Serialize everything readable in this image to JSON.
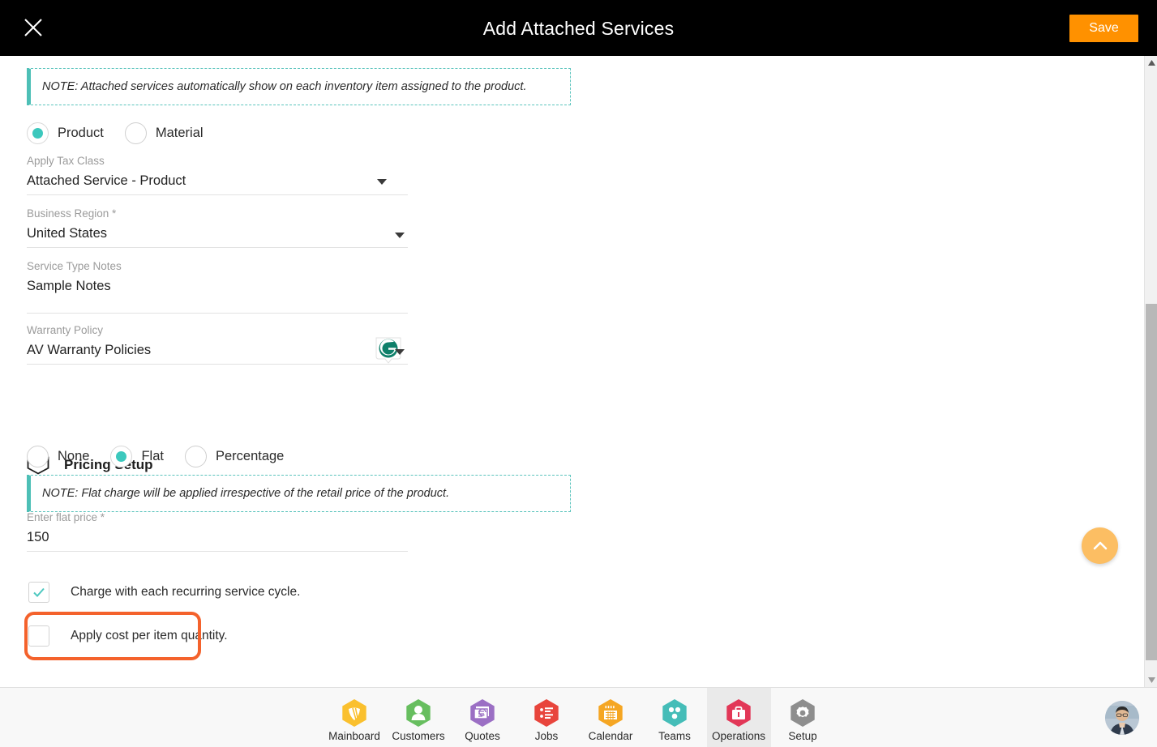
{
  "header": {
    "title": "Add Attached Services",
    "close_icon": "close-icon",
    "save_label": "Save"
  },
  "notes": {
    "top": "NOTE: Attached services automatically show on each inventory item assigned to the product.",
    "flat": "NOTE: Flat charge will be applied irrespective of the retail price of the product."
  },
  "type_radios": [
    {
      "label": "Product",
      "selected": true
    },
    {
      "label": "Material",
      "selected": false
    }
  ],
  "fields": {
    "tax_class": {
      "label": "Apply Tax Class",
      "value": "Attached Service - Product"
    },
    "region": {
      "label": "Business Region *",
      "value": "United States"
    },
    "notes": {
      "label": "Service Type Notes",
      "value": "Sample Notes"
    },
    "warranty": {
      "label": "Warranty Policy",
      "value": "AV Warranty Policies"
    },
    "flat_price": {
      "label": "Enter flat price *",
      "value": "150"
    }
  },
  "grammarly_icon": "grammarly-icon",
  "pricing": {
    "section_title": "Pricing Setup",
    "section_icon": "hexagon-outline-icon",
    "radios": [
      {
        "label": "None",
        "selected": false
      },
      {
        "label": "Flat",
        "selected": true
      },
      {
        "label": "Percentage",
        "selected": false
      }
    ]
  },
  "checkboxes": [
    {
      "label": "Charge with each recurring service cycle.",
      "checked": true
    },
    {
      "label": "Apply cost per item quantity.",
      "checked": false
    }
  ],
  "fab": {
    "icon": "chevron-up-icon"
  },
  "scrollbar": {
    "up_icon": "triangle-up-icon",
    "down_icon": "triangle-down-icon"
  },
  "nav": [
    {
      "label": "Mainboard",
      "icon": "mainboard-icon",
      "color": "#FAC02E",
      "active": false
    },
    {
      "label": "Customers",
      "icon": "customers-icon",
      "color": "#67BE5F",
      "active": false
    },
    {
      "label": "Quotes",
      "icon": "quotes-icon",
      "color": "#9B6FC4",
      "active": false
    },
    {
      "label": "Jobs",
      "icon": "jobs-icon",
      "color": "#E8453C",
      "active": false
    },
    {
      "label": "Calendar",
      "icon": "calendar-icon",
      "color": "#F5A623",
      "active": false
    },
    {
      "label": "Teams",
      "icon": "teams-icon",
      "color": "#45BDB8",
      "active": false
    },
    {
      "label": "Operations",
      "icon": "operations-icon",
      "color": "#E23757",
      "active": true
    },
    {
      "label": "Setup",
      "icon": "setup-icon",
      "color": "#8E8E8E",
      "active": false
    }
  ],
  "avatar": {
    "icon": "user-avatar"
  },
  "colors": {
    "header_bg": "#000000",
    "save_btn": "#FF9100",
    "accent_teal": "#3cc8bd",
    "highlight_ring": "#f4622c",
    "fab": "#FCBE63"
  }
}
